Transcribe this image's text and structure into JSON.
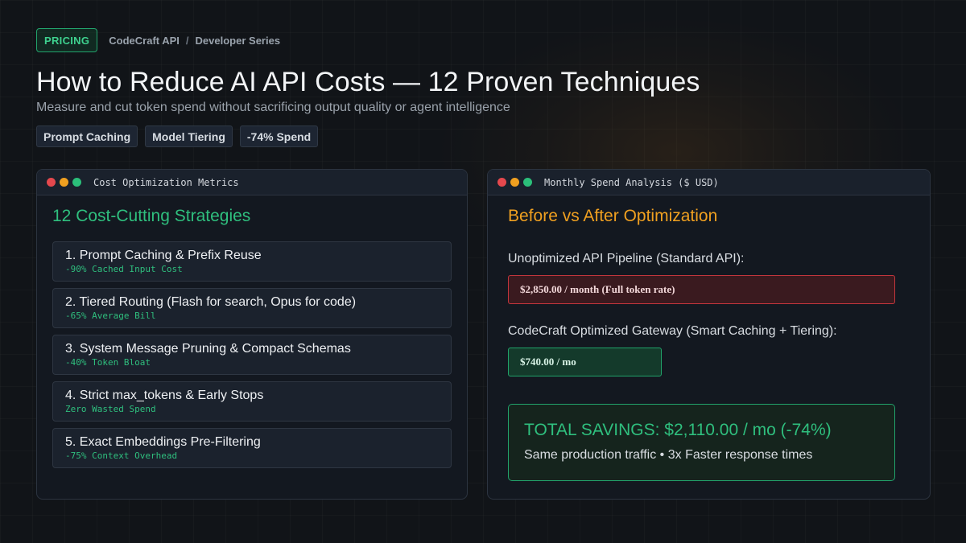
{
  "header": {
    "badge": "PRICING",
    "breadcrumb": [
      "CodeCraft API",
      "/",
      "Developer Series"
    ],
    "title": "How to Reduce AI API Costs — 12 Proven Techniques",
    "subtitle": "Measure and cut token spend without sacrificing output quality or agent intelligence",
    "tags": [
      "Prompt Caching",
      "Model Tiering",
      "-74% Spend"
    ]
  },
  "left_panel": {
    "window_title": "Cost Optimization Metrics",
    "heading": "12 Cost-Cutting Strategies",
    "items": [
      {
        "title": "1. Prompt Caching & Prefix Reuse",
        "metric": "-90% Cached Input Cost"
      },
      {
        "title": "2. Tiered Routing (Flash for search, Opus for code)",
        "metric": "-65% Average Bill"
      },
      {
        "title": "3. System Message Pruning & Compact Schemas",
        "metric": "-40% Token Bloat"
      },
      {
        "title": "4. Strict max_tokens & Early Stops",
        "metric": "Zero Wasted Spend"
      },
      {
        "title": "5. Exact Embeddings Pre-Filtering",
        "metric": "-75% Context Overhead"
      }
    ]
  },
  "right_panel": {
    "window_title": "Monthly Spend Analysis ($ USD)",
    "heading": "Before vs After Optimization",
    "before": {
      "label": "Unoptimized API Pipeline (Standard API):",
      "value": "$2,850.00 / month  (Full token rate)"
    },
    "after": {
      "label": "CodeCraft Optimized Gateway (Smart Caching + Tiering):",
      "value": "$740.00 / mo"
    },
    "savings": {
      "title": "TOTAL SAVINGS: $2,110.00 / mo (-74%)",
      "note": "Same production traffic • 3x Faster response times"
    }
  },
  "colors": {
    "accent_green": "#2fbf7e",
    "accent_orange": "#f0a020",
    "danger_red": "#c2353c",
    "background": "#111418"
  },
  "icons": [
    "window-close-dot-icon",
    "window-minimize-dot-icon",
    "window-maximize-dot-icon"
  ]
}
